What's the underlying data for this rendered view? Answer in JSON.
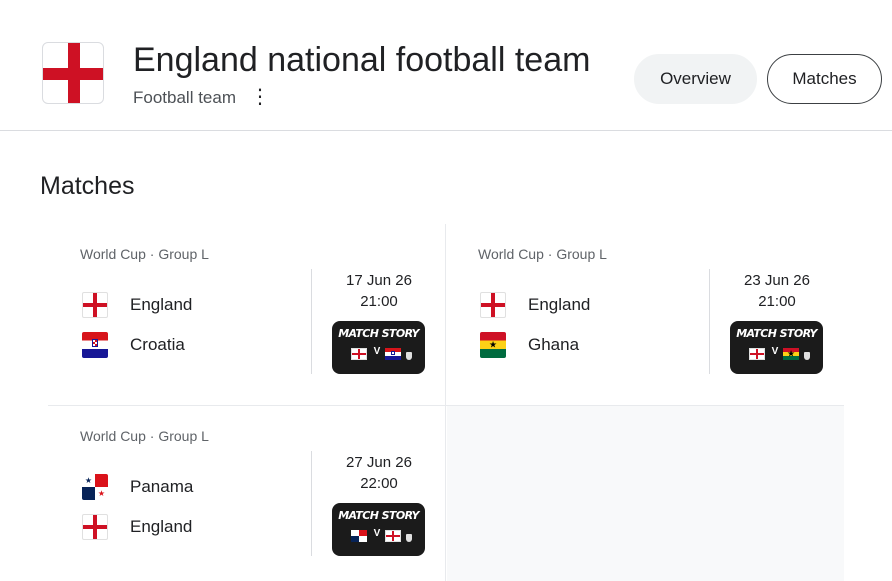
{
  "header": {
    "title": "England national football team",
    "subtitle": "Football team",
    "more_icon": "more-vert-icon",
    "flag_icon": "england-flag-icon",
    "chips": [
      {
        "label": "Overview"
      },
      {
        "label": "Matches"
      }
    ]
  },
  "section": {
    "title": "Matches"
  },
  "matches": [
    {
      "competition": "World Cup · Group L",
      "team1": "England",
      "team2": "Croatia",
      "date": "17 Jun 26",
      "time": "21:00",
      "story_label": "MATCH STORY",
      "vs": "V"
    },
    {
      "competition": "World Cup · Group L",
      "team1": "England",
      "team2": "Ghana",
      "date": "23 Jun 26",
      "time": "21:00",
      "story_label": "MATCH STORY",
      "vs": "V"
    },
    {
      "competition": "World Cup · Group L",
      "team1": "Panama",
      "team2": "England",
      "date": "27 Jun 26",
      "time": "22:00",
      "story_label": "MATCH STORY",
      "vs": "V"
    }
  ],
  "colors": {
    "england_red": "#ce1124",
    "chip_bg": "#f1f3f4",
    "story_bg": "#1b1b1b"
  }
}
